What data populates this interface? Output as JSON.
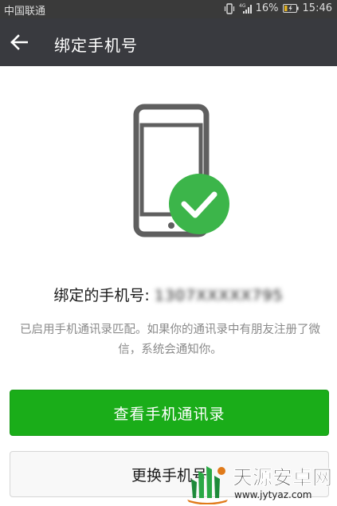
{
  "status_bar": {
    "carrier": "中国联通",
    "network": "4G",
    "battery_percent": "16%",
    "time": "15:46"
  },
  "app_bar": {
    "back_icon": "back-arrow-icon",
    "title": "绑定手机号"
  },
  "illustration": {
    "icon": "phone-check-icon",
    "check_color": "#3cb54a",
    "phone_color": "#5f5f5f"
  },
  "bound": {
    "label": "绑定的手机号: ",
    "number": "1307XXXXX795"
  },
  "description": "已启用手机通讯录匹配。如果你的通讯录中有朋友注册了微信，系统会通知你。",
  "buttons": {
    "view_contacts": "查看手机通讯录",
    "change_number": "更换手机号"
  },
  "watermark": {
    "title": "天源安卓网",
    "url": "www.jytyaz.com"
  },
  "colors": {
    "status_bar": "#3a3a3a",
    "app_bar": "#393a3f",
    "primary": "#1aad19"
  }
}
